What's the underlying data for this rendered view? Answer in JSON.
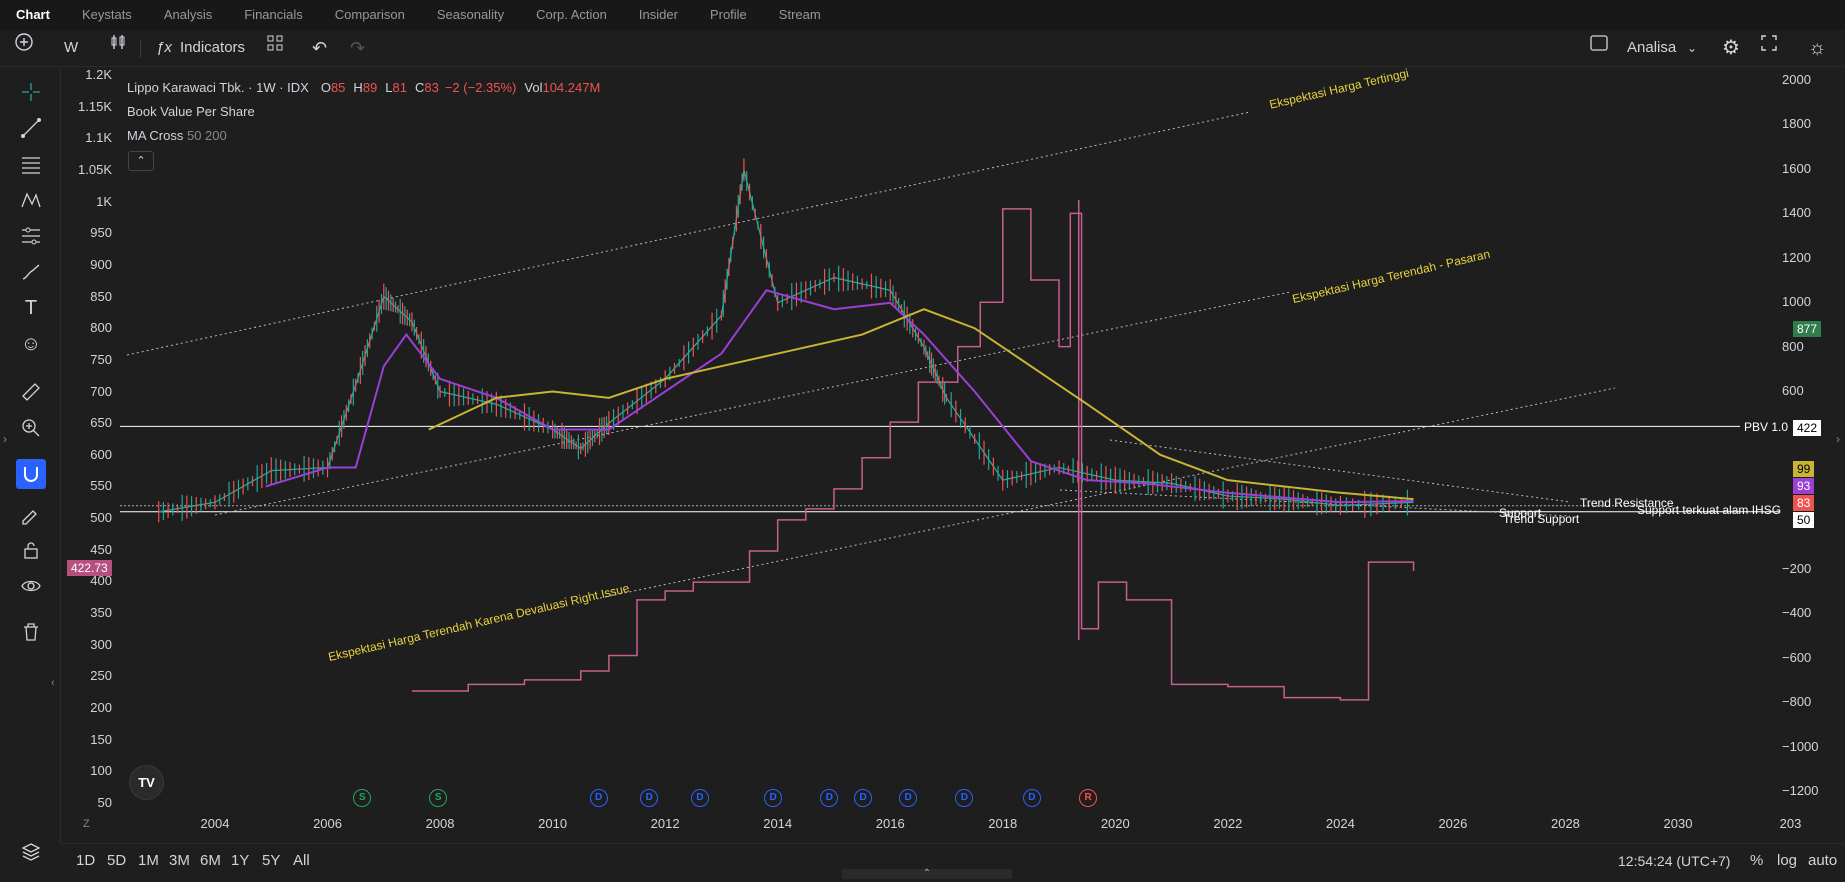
{
  "tabs": [
    "Chart",
    "Keystats",
    "Analysis",
    "Financials",
    "Comparison",
    "Seasonality",
    "Corp. Action",
    "Insider",
    "Profile",
    "Stream"
  ],
  "toolbar": {
    "interval": "W",
    "indicators_label": "Indicators",
    "layout_name": "Analisa"
  },
  "legend": {
    "symbol": "Lippo Karawaci Tbk. · 1W · IDX",
    "open_label": "O",
    "open": "85",
    "high_label": "H",
    "high": "89",
    "low_label": "L",
    "low": "81",
    "close_label": "C",
    "close": "83",
    "change": "−2 (−2.35%)",
    "vol_label": "Vol",
    "vol": "104.247M",
    "indicator1": "Book Value Per Share",
    "indicator2_name": "MA Cross",
    "indicator2_params": "50 200"
  },
  "left_axis_labels": [
    "1.2K",
    "1.15K",
    "1.1K",
    "1.05K",
    "1K",
    "950",
    "900",
    "850",
    "800",
    "750",
    "700",
    "650",
    "600",
    "550",
    "500",
    "450",
    "400",
    "350",
    "300",
    "250",
    "200",
    "150",
    "100",
    "50"
  ],
  "right_axis_labels": [
    "2000",
    "1800",
    "1600",
    "1400",
    "1200",
    "1000",
    "800",
    "600",
    "−200",
    "−400",
    "−600",
    "−800",
    "−1000",
    "−1200"
  ],
  "x_axis_labels": [
    "2004",
    "2006",
    "2008",
    "2010",
    "2012",
    "2014",
    "2016",
    "2018",
    "2020",
    "2022",
    "2024",
    "2026",
    "2028",
    "2030",
    "203"
  ],
  "left_price_badge": "422.73",
  "right_badges": {
    "bvps": "877",
    "pbv_value": "422",
    "ma200": "99",
    "ma50": "93",
    "close": "83",
    "support": "50"
  },
  "annotations": {
    "top_channel": "Ekspektasi Harga Tertinggi",
    "mid_channel": "Ekspektasi Harga Terendah - Pasaran",
    "low_channel": "Ekspektasi Harga Terendah Karena Devaluasi Right Issue",
    "pbv_line": "PBV 1.0",
    "trend_resistance": "Trend Resistance",
    "support": "Support",
    "trend_support": "Trend Support",
    "support_ihsg": "Support terkuat alam IHSG"
  },
  "corporate_events": [
    "S",
    "S",
    "D",
    "D",
    "D",
    "D",
    "D",
    "D",
    "D",
    "D",
    "D",
    "R"
  ],
  "zoom_corner": "Z",
  "bottom": {
    "ranges": [
      "1D",
      "5D",
      "1M",
      "3M",
      "6M",
      "1Y",
      "5Y",
      "All"
    ],
    "time": "12:54:24 (UTC+7)",
    "percent": "%",
    "log": "log",
    "auto": "auto"
  },
  "colors": {
    "background": "#1e1e1e",
    "candle_up": "#26a69a",
    "candle_down": "#ef5350",
    "ma50": "#9c3fd6",
    "ma200": "#c8b534",
    "bvps": "#c45f8e",
    "annotation": "#e8d33f",
    "dividend": "#2962ff",
    "split": "#26a65b",
    "rights": "#ef5350"
  },
  "chart_data": {
    "type": "line",
    "title": "Lippo Karawaci Tbk. · 1W · IDX",
    "x": [
      "2003",
      "2004",
      "2005",
      "2006",
      "2006.5",
      "2007",
      "2007.5",
      "2008",
      "2009",
      "2010",
      "2010.5",
      "2011",
      "2012",
      "2013",
      "2013.4",
      "2014",
      "2015",
      "2016",
      "2016.6",
      "2017",
      "2018",
      "2019",
      "2020",
      "2021",
      "2022",
      "2023",
      "2024",
      "2025.3"
    ],
    "series": [
      {
        "name": "Price (approx. close)",
        "values": [
          510,
          525,
          575,
          580,
          710,
          850,
          810,
          700,
          680,
          640,
          610,
          650,
          720,
          820,
          1050,
          840,
          880,
          860,
          770,
          690,
          560,
          580,
          560,
          555,
          535,
          530,
          520,
          525
        ]
      }
    ],
    "ma_cross_periods": [
      50,
      200
    ],
    "ylim": [
      50,
      1200
    ],
    "right_axis_range": [
      -1200,
      2000
    ],
    "bvps_last": "422.73",
    "horizontal_levels": {
      "PBV 1.0": 645,
      "Support": 510
    }
  }
}
